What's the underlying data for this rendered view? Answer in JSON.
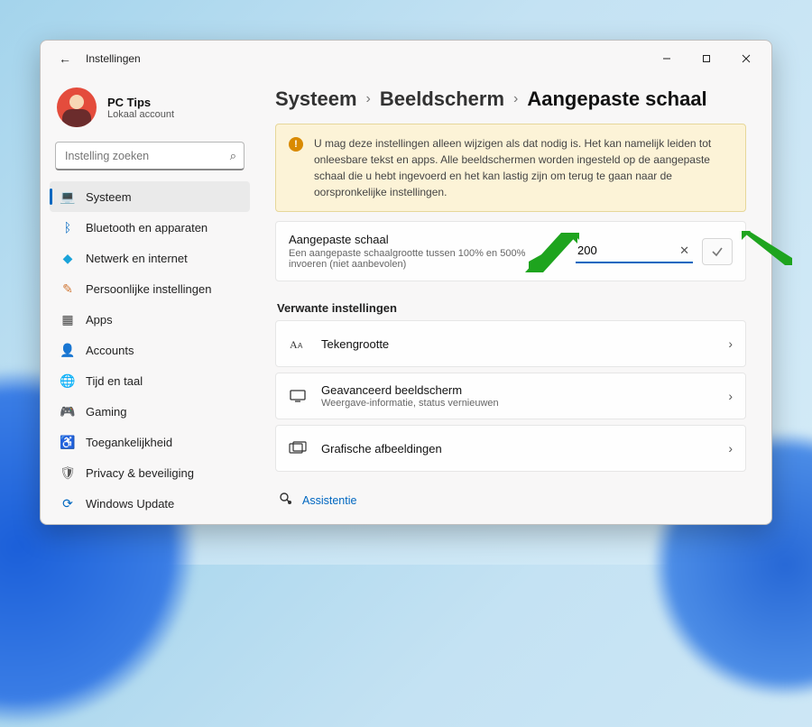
{
  "window": {
    "title": "Instellingen"
  },
  "profile": {
    "name": "PC Tips",
    "account": "Lokaal account"
  },
  "search": {
    "placeholder": "Instelling zoeken"
  },
  "sidebar": {
    "items": [
      {
        "label": "Systeem",
        "icon": "💻",
        "color": "#0067c0",
        "active": true
      },
      {
        "label": "Bluetooth en apparaten",
        "icon": "ᛒ",
        "color": "#0067c0"
      },
      {
        "label": "Netwerk en internet",
        "icon": "◆",
        "color": "#1aa3d9"
      },
      {
        "label": "Persoonlijke instellingen",
        "icon": "✎",
        "color": "#d07735"
      },
      {
        "label": "Apps",
        "icon": "▦",
        "color": "#444"
      },
      {
        "label": "Accounts",
        "icon": "👤",
        "color": "#e39a2b"
      },
      {
        "label": "Tijd en taal",
        "icon": "🌐",
        "color": "#2a8f6f"
      },
      {
        "label": "Gaming",
        "icon": "🎮",
        "color": "#777"
      },
      {
        "label": "Toegankelijkheid",
        "icon": "♿",
        "color": "#1f6fb5"
      },
      {
        "label": "Privacy & beveiliging",
        "icon": "🛡",
        "color": "#5b5b5b"
      },
      {
        "label": "Windows Update",
        "icon": "⟳",
        "color": "#0067c0"
      }
    ]
  },
  "breadcrumbs": {
    "a": "Systeem",
    "b": "Beeldscherm",
    "c": "Aangepaste schaal"
  },
  "warning": {
    "text": "U mag deze instellingen alleen wijzigen als dat nodig is. Het kan namelijk leiden tot onleesbare tekst en apps. Alle beeldschermen worden ingesteld op de aangepaste schaal die u hebt ingevoerd en het kan lastig zijn om terug te gaan naar de oorspronkelijke instellingen."
  },
  "customScale": {
    "title": "Aangepaste schaal",
    "subtitle": "Een aangepaste schaalgrootte tussen 100% en 500% invoeren (niet aanbevolen)",
    "value": "200"
  },
  "related": {
    "heading": "Verwante instellingen",
    "rows": [
      {
        "title": "Tekengrootte",
        "subtitle": "",
        "icon": "text-size"
      },
      {
        "title": "Geavanceerd beeldscherm",
        "subtitle": "Weergave-informatie, status vernieuwen",
        "icon": "monitor"
      },
      {
        "title": "Grafische afbeeldingen",
        "subtitle": "",
        "icon": "graphics"
      }
    ]
  },
  "assist": {
    "label": "Assistentie"
  }
}
